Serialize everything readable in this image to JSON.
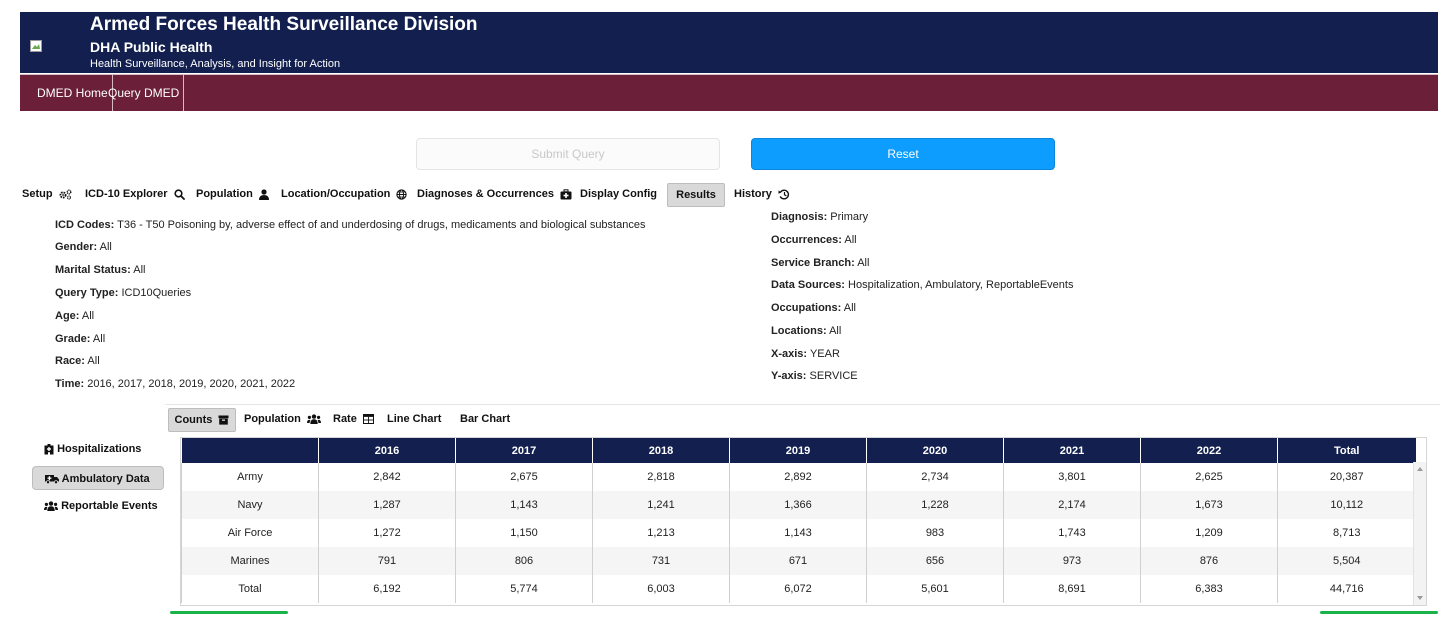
{
  "header": {
    "title": "Armed Forces Health Surveillance Division",
    "subtitle": "DHA Public Health",
    "tagline": "Health Surveillance, Analysis, and Insight for Action"
  },
  "nav": [
    {
      "label": "DMED Home"
    },
    {
      "label": "Query DMED"
    }
  ],
  "actions": {
    "submit_label": "Submit Query",
    "reset_label": "Reset"
  },
  "tabs": [
    {
      "label": "Setup",
      "icon": "gears-icon"
    },
    {
      "label": "ICD-10 Explorer",
      "icon": "search-icon"
    },
    {
      "label": "Population",
      "icon": "user-icon"
    },
    {
      "label": "Location/Occupation",
      "icon": "globe-icon"
    },
    {
      "label": "Diagnoses & Occurrences",
      "icon": "medkit-icon"
    },
    {
      "label": "Display Config",
      "icon": ""
    },
    {
      "label": "Results",
      "icon": "",
      "active": true
    },
    {
      "label": "History",
      "icon": "history-icon"
    }
  ],
  "summary": {
    "left": [
      {
        "key": "ICD Codes:",
        "value": "T36 - T50 Poisoning by, adverse effect of and underdosing of drugs, medicaments and biological substances"
      },
      {
        "key": "Gender:",
        "value": "All"
      },
      {
        "key": "Marital Status:",
        "value": "All"
      },
      {
        "key": "Query Type:",
        "value": "ICD10Queries"
      },
      {
        "key": "Age:",
        "value": "All"
      },
      {
        "key": "Grade:",
        "value": "All"
      },
      {
        "key": "Race:",
        "value": "All"
      },
      {
        "key": "Time:",
        "value": "2016, 2017, 2018, 2019, 2020, 2021, 2022"
      }
    ],
    "right": [
      {
        "key": "Diagnosis:",
        "value": "Primary"
      },
      {
        "key": "Occurrences:",
        "value": "All"
      },
      {
        "key": "Service Branch:",
        "value": "All"
      },
      {
        "key": "Data Sources:",
        "value": "Hospitalization, Ambulatory, ReportableEvents"
      },
      {
        "key": "Occupations:",
        "value": "All"
      },
      {
        "key": "Locations:",
        "value": "All"
      },
      {
        "key": "X-axis:",
        "value": "YEAR"
      },
      {
        "key": "Y-axis:",
        "value": "SERVICE"
      }
    ]
  },
  "subtabs": [
    {
      "label": "Counts",
      "icon": "archive-icon",
      "active": true
    },
    {
      "label": "Population",
      "icon": "users-icon"
    },
    {
      "label": "Rate",
      "icon": "table-icon"
    },
    {
      "label": "Line Chart",
      "icon": ""
    },
    {
      "label": "Bar Chart",
      "icon": ""
    }
  ],
  "sidenav": [
    {
      "label": "Hospitalizations",
      "icon": "hospital-icon"
    },
    {
      "label": "Ambulatory Data",
      "icon": "ambulance-icon",
      "active": true
    },
    {
      "label": "Reportable Events",
      "icon": "users-icon"
    }
  ],
  "table": {
    "columns": [
      "",
      "2016",
      "2017",
      "2018",
      "2019",
      "2020",
      "2021",
      "2022",
      "Total"
    ],
    "rows": [
      [
        "Army",
        "2,842",
        "2,675",
        "2,818",
        "2,892",
        "2,734",
        "3,801",
        "2,625",
        "20,387"
      ],
      [
        "Navy",
        "1,287",
        "1,143",
        "1,241",
        "1,366",
        "1,228",
        "2,174",
        "1,673",
        "10,112"
      ],
      [
        "Air Force",
        "1,272",
        "1,150",
        "1,213",
        "1,143",
        "983",
        "1,743",
        "1,209",
        "8,713"
      ],
      [
        "Marines",
        "791",
        "806",
        "731",
        "671",
        "656",
        "973",
        "876",
        "5,504"
      ],
      [
        "Total",
        "6,192",
        "5,774",
        "6,003",
        "6,072",
        "5,601",
        "8,691",
        "6,383",
        "44,716"
      ]
    ]
  },
  "colors": {
    "header_bg": "#13204f",
    "nav_bg": "#6b1f38",
    "reset_bg": "#0d9dff",
    "active_tab_bg": "#d9d9d9"
  }
}
